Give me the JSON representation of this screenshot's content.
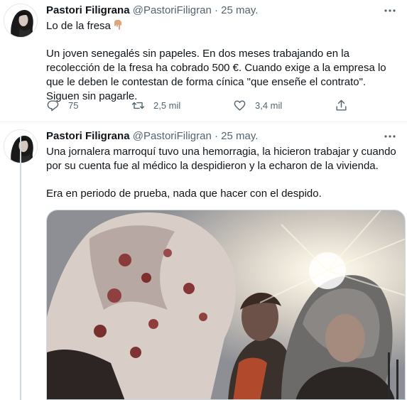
{
  "tweets": [
    {
      "author_name": "Pastori Filigrana",
      "handle": "@PastoriFiligran",
      "separator": "·",
      "date": "25 may.",
      "line1": "Lo de la fresa",
      "line1_emoji": "pointing-down-hand-emoji",
      "body": "Un joven senegalés sin papeles. En dos meses trabajando en la recolección de la fresa ha cobrado 500 €. Cuando exige a la empresa  lo que le deben le contestan de forma cínica \"que enseñe el contrato\". Siguen sin pagarle.",
      "replies": "75",
      "retweets": "2,5 mil",
      "likes": "3,4 mil"
    },
    {
      "author_name": "Pastori Filigrana",
      "handle": "@PastoriFiligran",
      "separator": "·",
      "date": "25 may.",
      "body1": "Una jornalera marroquí  tuvo una hemorragia, la hicieron trabajar y cuando por su cuenta fue al médico la despidieron y la echaron de la vivienda.",
      "body2": "Era en periodo de prueba, nada que hacer con el despido."
    }
  ],
  "icons": {
    "more": "more-horizontal-icon",
    "reply": "reply-icon",
    "retweet": "retweet-icon",
    "like": "heart-icon",
    "share": "share-icon"
  },
  "colors": {
    "text": "#0f1419",
    "secondary": "#536471",
    "thread_line": "#cfd9de"
  }
}
